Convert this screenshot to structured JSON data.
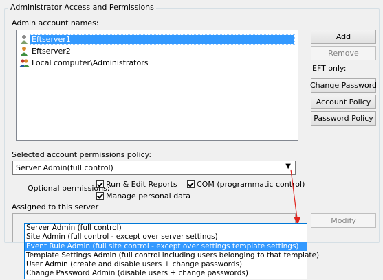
{
  "group": {
    "title": "Administrator Access and Permissions"
  },
  "admin_names": {
    "label": "Admin account names:",
    "items": [
      {
        "name": "Eftserver1",
        "icon": "user-icon",
        "selected": true
      },
      {
        "name": "Eftserver2",
        "icon": "user-icon",
        "selected": false
      },
      {
        "name": "Local computer\\Administrators",
        "icon": "group-users-icon",
        "selected": false
      }
    ]
  },
  "buttons": {
    "add": "Add",
    "remove": "Remove",
    "eft_only_label": "EFT only:",
    "change_password": "Change Password",
    "account_policy": "Account Policy",
    "password_policy": "Password Policy",
    "modify": "Modify"
  },
  "policy": {
    "label": "Selected account permissions policy:",
    "selected": "Server Admin(full control)",
    "options": [
      "Server Admin (full control)",
      "Site Admin (full control - except over server settings)",
      "Event Rule Admin (full site control - except over settings template settings)",
      "Template Settings Admin (full control including users belonging to that template)",
      "User Admin (create and disable users + change passwords)",
      "Change Password Admin (disable users + change passwords)"
    ],
    "highlighted_index": 2
  },
  "optional": {
    "label": "Optional permissions:",
    "run_edit_reports": {
      "label": "Run & Edit Reports",
      "checked": true
    },
    "com": {
      "label": "COM (programmatic control)",
      "checked": true
    },
    "manage_personal_data": {
      "label": "Manage personal data",
      "checked": true
    }
  },
  "assigned": {
    "label": "Assigned to this server"
  },
  "colors": {
    "selection": "#3399ff",
    "annotation_arrow": "#e0241e"
  }
}
